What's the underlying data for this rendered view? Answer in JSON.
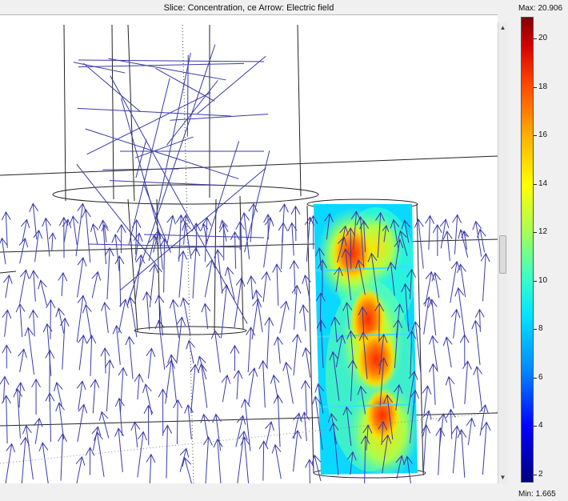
{
  "plot": {
    "title": "Slice: Concentration, ce   Arrow: Electric field"
  },
  "colorbar": {
    "max_label": "Max: 20.906",
    "min_label": "Min: 1.665",
    "min": 1.665,
    "max": 20.906,
    "ticks": [
      {
        "value": 20,
        "label": "20"
      },
      {
        "value": 18,
        "label": "18"
      },
      {
        "value": 16,
        "label": "16"
      },
      {
        "value": 14,
        "label": "14"
      },
      {
        "value": 12,
        "label": "12"
      },
      {
        "value": 10,
        "label": "10"
      },
      {
        "value": 8,
        "label": "8"
      },
      {
        "value": 6,
        "label": "6"
      },
      {
        "value": 4,
        "label": "4"
      },
      {
        "value": 2,
        "label": "2"
      }
    ],
    "colormap": "jet"
  },
  "colors": {
    "arrow": "#3333aa",
    "wireframe": "#222222",
    "slice_low": "#00e5ff",
    "slice_high": "#ff3300"
  },
  "icons": {
    "scroll_up": "▲",
    "scroll_down": "▼"
  }
}
